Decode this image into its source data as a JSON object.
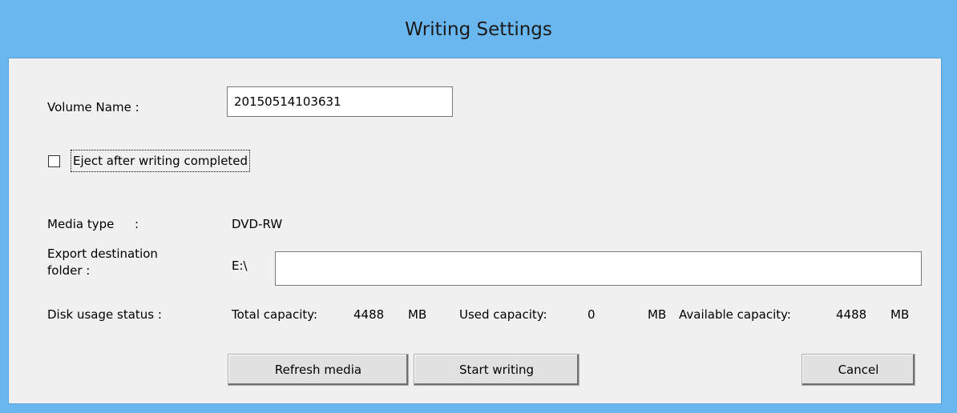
{
  "window": {
    "title": "Writing Settings"
  },
  "volume": {
    "label": "Volume Name :",
    "value": "20150514103631"
  },
  "eject": {
    "label": "Eject after writing completed",
    "checked": false
  },
  "media": {
    "label": "Media type",
    "colon": ":",
    "value": "DVD-RW"
  },
  "export": {
    "label_line1": "Export destination",
    "label_line2": "folder :",
    "drive": "E:\\",
    "value": ""
  },
  "disk": {
    "label": "Disk usage status :",
    "total_label": "Total capacity:",
    "total_value": "4488",
    "total_unit": "MB",
    "used_label": "Used capacity:",
    "used_value": "0",
    "used_unit": "MB",
    "avail_label": "Available capacity:",
    "avail_value": "4488",
    "avail_unit": "MB"
  },
  "buttons": {
    "refresh": "Refresh media",
    "start": "Start writing",
    "cancel": "Cancel"
  }
}
